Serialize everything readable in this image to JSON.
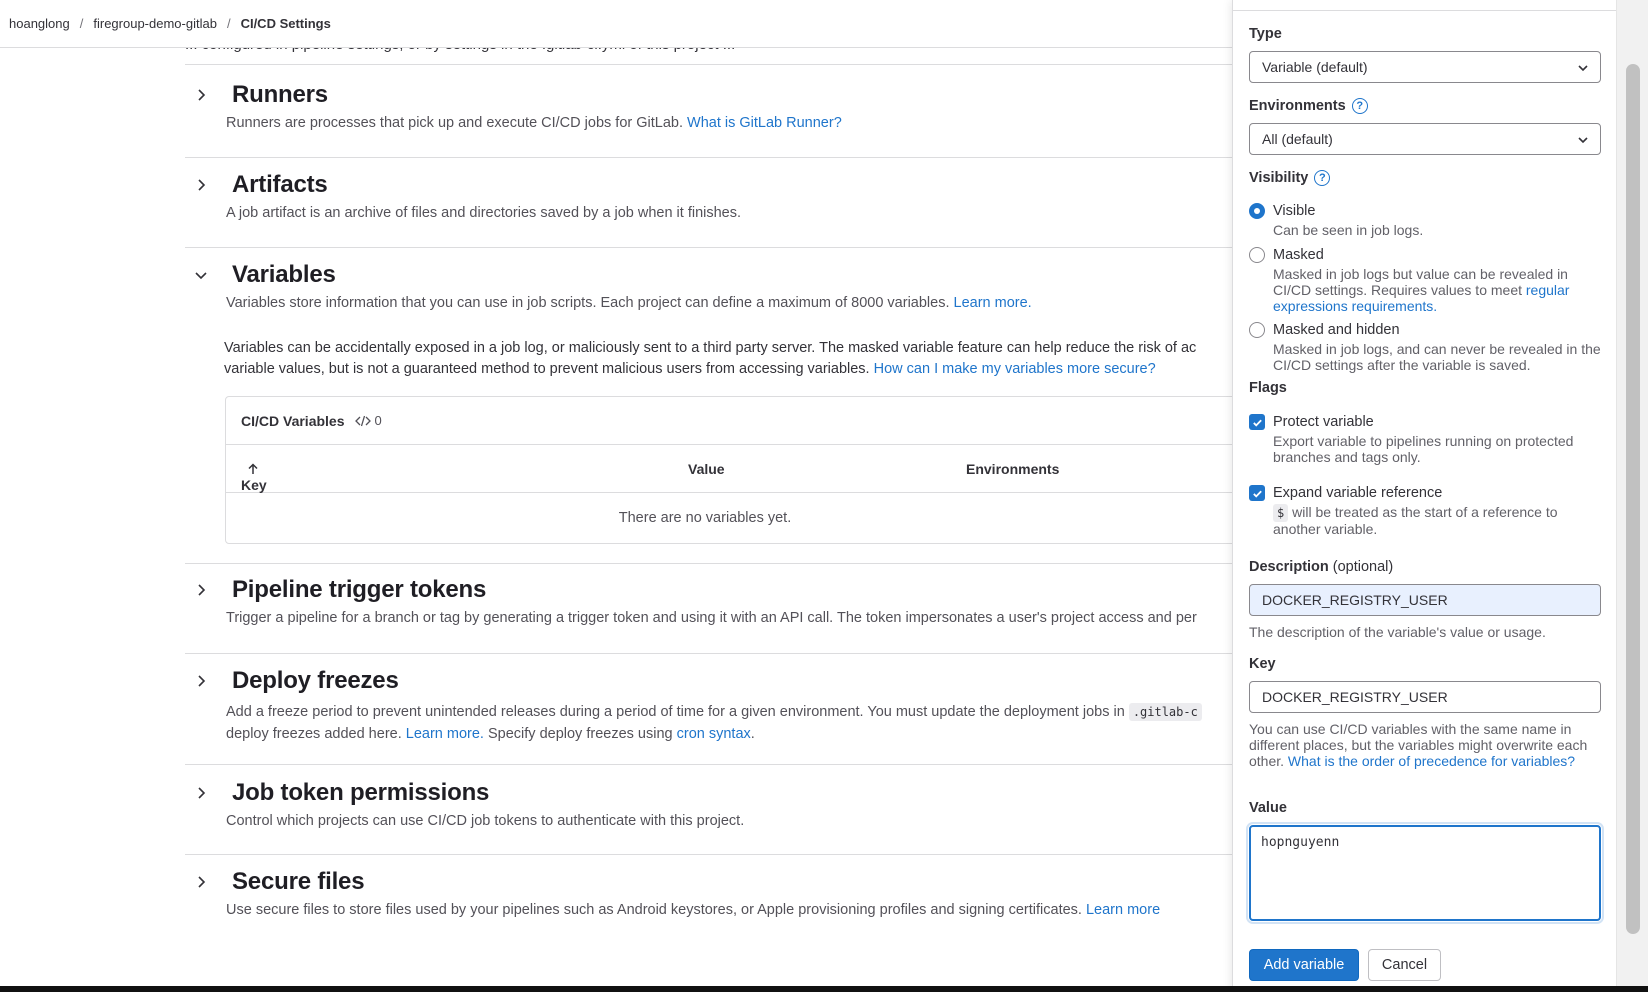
{
  "breadcrumb": {
    "items": [
      "hoanglong",
      "firegroup-demo-gitlab",
      "CI/CD Settings"
    ],
    "separator": "/"
  },
  "clipped_line": "... configured in pipeline settings, or by settings in the .gitlab-ci.yml of this project ...",
  "sections": {
    "runners": {
      "title": "Runners",
      "desc": "Runners are processes that pick up and execute CI/CD jobs for GitLab.",
      "link": "What is GitLab Runner?"
    },
    "artifacts": {
      "title": "Artifacts",
      "desc": "A job artifact is an archive of files and directories saved by a job when it finishes."
    },
    "variables": {
      "title": "Variables",
      "desc": "Variables store information that you can use in job scripts. Each project can define a maximum of 8000 variables.",
      "link": "Learn more.",
      "warning_line1": "Variables can be accidentally exposed in a job log, or maliciously sent to a third party server. The masked variable feature can help reduce the risk of ac",
      "warning_line2": "variable values, but is not a guaranteed method to prevent malicious users from accessing variables.",
      "warning_link": "How can I make my variables more secure?",
      "card_title": "CI/CD Variables",
      "count": "0",
      "col_key": "Key",
      "col_value": "Value",
      "col_env": "Environments",
      "empty": "There are no variables yet."
    },
    "triggers": {
      "title": "Pipeline trigger tokens",
      "desc": "Trigger a pipeline for a branch or tag by generating a trigger token and using it with an API call. The token impersonates a user's project access and per"
    },
    "freezes": {
      "title": "Deploy freezes",
      "desc_line1": "Add a freeze period to prevent unintended releases during a period of time for a given environment. You must update the deployment jobs in",
      "code": ".gitlab-c",
      "desc_line2": "deploy freezes added here.",
      "link1": "Learn more.",
      "mid": "Specify deploy freezes using",
      "link2": "cron syntax",
      "end": "."
    },
    "job_token": {
      "title": "Job token permissions",
      "desc": "Control which projects can use CI/CD job tokens to authenticate with this project."
    },
    "secure_files": {
      "title": "Secure files",
      "desc": "Use secure files to store files used by your pipelines such as Android keystores, or Apple provisioning profiles and signing certificates.",
      "link": "Learn more"
    }
  },
  "drawer": {
    "type_label": "Type",
    "type_value": "Variable (default)",
    "env_label": "Environments",
    "env_value": "All (default)",
    "visibility_label": "Visibility",
    "visibility_options": [
      {
        "label": "Visible",
        "help": "Can be seen in job logs.",
        "checked": true
      },
      {
        "label": "Masked",
        "help": "Masked in job logs but value can be revealed in CI/CD settings. Requires values to meet",
        "link": "regular expressions requirements.",
        "checked": false
      },
      {
        "label": "Masked and hidden",
        "help": "Masked in job logs, and can never be revealed in the CI/CD settings after the variable is saved.",
        "checked": false
      }
    ],
    "flags_label": "Flags",
    "flag_protect_label": "Protect variable",
    "flag_protect_help": "Export variable to pipelines running on protected branches and tags only.",
    "flag_expand_label": "Expand variable reference",
    "flag_expand_code": "$",
    "flag_expand_help": "will be treated as the start of a reference to another variable.",
    "description_label": "Description",
    "description_optional": "(optional)",
    "description_value": "DOCKER_REGISTRY_USER",
    "description_help": "The description of the variable's value or usage.",
    "key_label": "Key",
    "key_value": "DOCKER_REGISTRY_USER",
    "key_help": "You can use CI/CD variables with the same name in different places, but the variables might overwrite each other.",
    "key_help_link": "What is the order of precedence for variables?",
    "value_label": "Value",
    "value_value": "hopnguyenn",
    "add_button": "Add variable",
    "cancel_button": "Cancel"
  },
  "colors": {
    "accent": "#1f75cb",
    "text": "#333238",
    "border": "#dcdcde"
  }
}
